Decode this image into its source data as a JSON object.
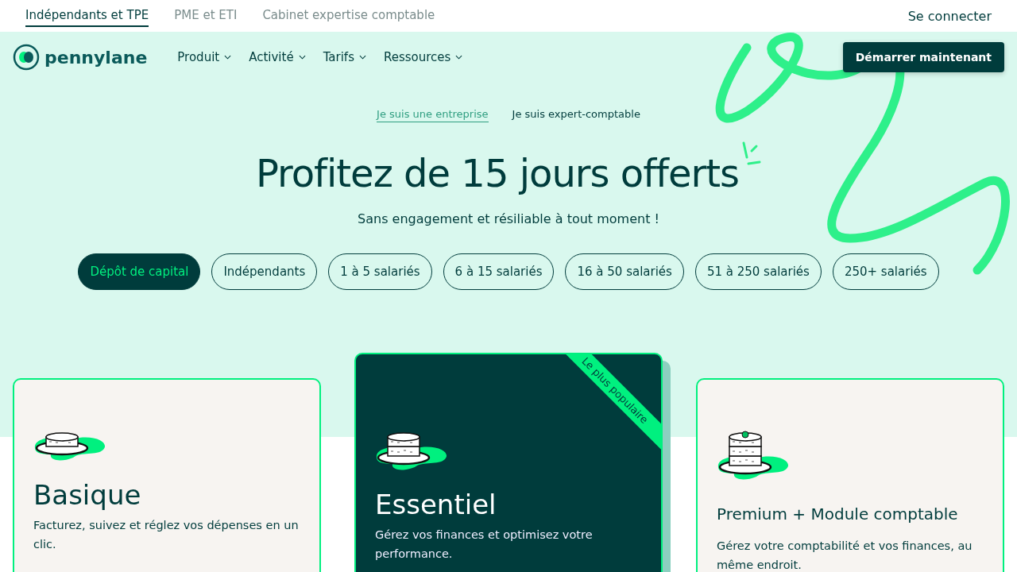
{
  "top_tabs": [
    {
      "label": "Indépendants et TPE",
      "selected": true
    },
    {
      "label": "PME et ETI",
      "selected": false
    },
    {
      "label": "Cabinet expertise comptable",
      "selected": false
    }
  ],
  "login": "Se connecter",
  "logo": "pennylane",
  "nav": [
    {
      "label": "Produit"
    },
    {
      "label": "Activité"
    },
    {
      "label": "Tarifs"
    },
    {
      "label": "Ressources"
    }
  ],
  "cta": "Démarrer maintenant",
  "audience": [
    {
      "label": "Je suis une entreprise",
      "selected": true
    },
    {
      "label": "Je suis expert-comptable",
      "selected": false
    }
  ],
  "title": "Profitez de 15 jours offerts",
  "subtitle": "Sans engagement et résiliable à tout moment !",
  "segments": [
    {
      "label": "Dépôt de capital",
      "selected": true
    },
    {
      "label": "Indépendants",
      "selected": false
    },
    {
      "label": "1 à 5 salariés",
      "selected": false
    },
    {
      "label": "6 à 15 salariés",
      "selected": false
    },
    {
      "label": "16 à 50 salariés",
      "selected": false
    },
    {
      "label": "51 à 250 salariés",
      "selected": false
    },
    {
      "label": "250+ salariés",
      "selected": false
    }
  ],
  "plans": [
    {
      "kind": "standard",
      "title": "Basique",
      "description": "Facturez, suivez et réglez vos dépenses en un clic."
    },
    {
      "kind": "featured",
      "title": "Essentiel",
      "description": "Gérez vos finances et optimisez votre performance.",
      "ribbon": "Le plus populaire"
    },
    {
      "kind": "standard",
      "title": "Premium + Module comptable",
      "description": "Gérez votre comptabilité et vos finances, au même endroit."
    }
  ]
}
